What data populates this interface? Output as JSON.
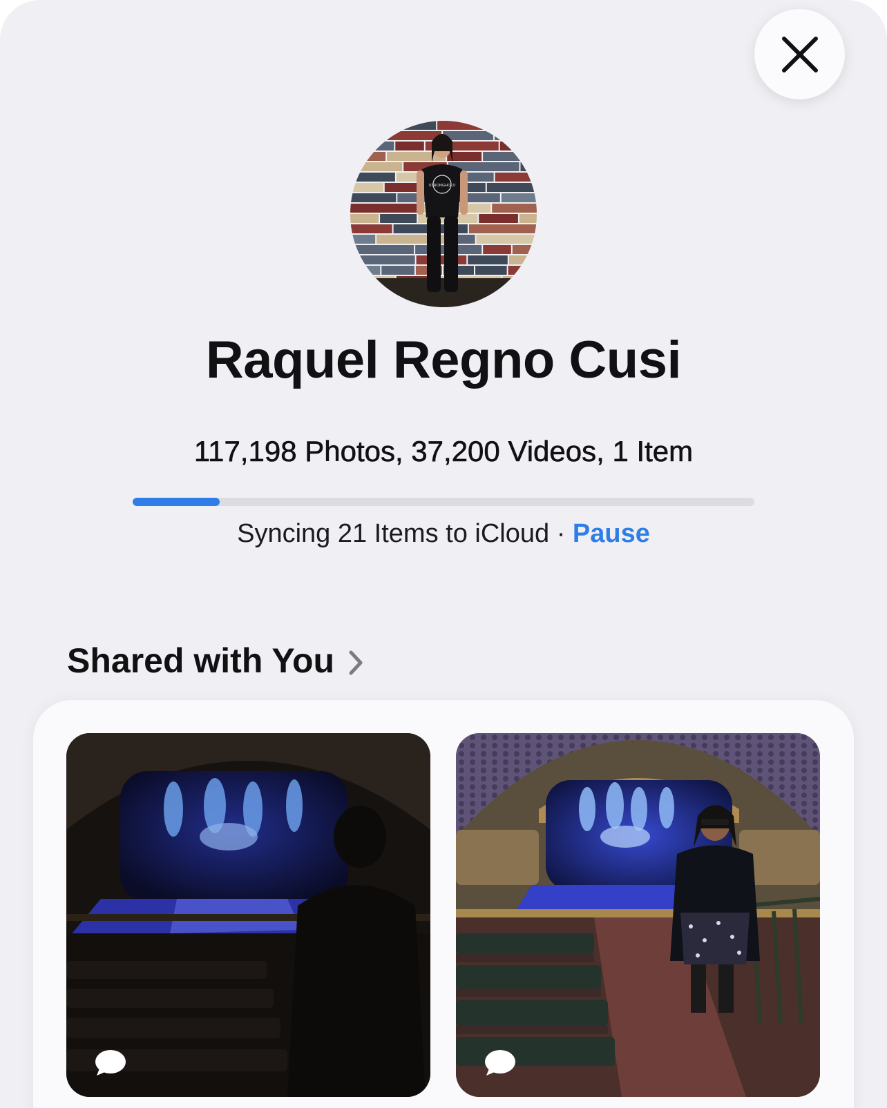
{
  "profile": {
    "name": "Raquel Regno Cusi",
    "avatar_icon": "profile-photo",
    "shirt_text": "STRONGHOLD"
  },
  "library": {
    "counts_text": "117,198 Photos, 37,200 Videos, 1 Item"
  },
  "sync": {
    "status_text": "Syncing 21 Items to iCloud",
    "separator": "·",
    "pause_label": "Pause",
    "progress_fraction": 0.14
  },
  "shared_with_you": {
    "title": "Shared with You",
    "items": [
      {
        "kind": "photo",
        "badge_icon": "message-bubble-icon",
        "description_icon": "theater-photo"
      },
      {
        "kind": "photo",
        "badge_icon": "message-bubble-icon",
        "description_icon": "theater-photo"
      }
    ]
  },
  "colors": {
    "accent": "#2f7ee8",
    "background": "#efeff4",
    "text": "#111114"
  },
  "icons": {
    "close": "close-icon",
    "chevron": "chevron-right-icon"
  }
}
